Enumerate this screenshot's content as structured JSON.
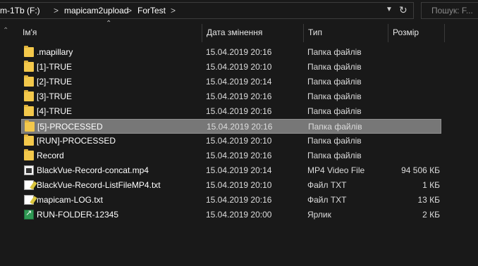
{
  "address": {
    "crumbs": [
      "m-1Tb (F:)",
      "mapicam2upload",
      "ForTest"
    ],
    "separators": [
      ">",
      ">",
      ">"
    ]
  },
  "search": {
    "placeholder": "Пошук: F..."
  },
  "columns": {
    "name": "Ім'я",
    "date": "Дата змінення",
    "type": "Тип",
    "size": "Розмір"
  },
  "files": [
    {
      "name": ".mapillary",
      "date": "15.04.2019 20:16",
      "type": "Папка файлів",
      "size": "",
      "icon": "folder-icon"
    },
    {
      "name": "[1]-TRUE",
      "date": "15.04.2019 20:10",
      "type": "Папка файлів",
      "size": "",
      "icon": "folder-icon"
    },
    {
      "name": "[2]-TRUE",
      "date": "15.04.2019 20:14",
      "type": "Папка файлів",
      "size": "",
      "icon": "folder-icon"
    },
    {
      "name": "[3]-TRUE",
      "date": "15.04.2019 20:16",
      "type": "Папка файлів",
      "size": "",
      "icon": "folder-icon"
    },
    {
      "name": "[4]-TRUE",
      "date": "15.04.2019 20:16",
      "type": "Папка файлів",
      "size": "",
      "icon": "folder-icon"
    },
    {
      "name": "[5]-PROCESSED",
      "date": "15.04.2019 20:16",
      "type": "Папка файлів",
      "size": "",
      "icon": "folder-icon",
      "selected": true
    },
    {
      "name": "[RUN]-PROCESSED",
      "date": "15.04.2019 20:10",
      "type": "Папка файлів",
      "size": "",
      "icon": "folder-icon"
    },
    {
      "name": "Record",
      "date": "15.04.2019 20:16",
      "type": "Папка файлів",
      "size": "",
      "icon": "folder-icon"
    },
    {
      "name": "BlackVue-Record-concat.mp4",
      "date": "15.04.2019 20:14",
      "type": "MP4 Video File",
      "size": "94 506 КБ",
      "icon": "video-file-icon"
    },
    {
      "name": "BlackVue-Record-ListFileMP4.txt",
      "date": "15.04.2019 20:10",
      "type": "Файл TXT",
      "size": "1 КБ",
      "icon": "text-file-icon"
    },
    {
      "name": "mapicam-LOG.txt",
      "date": "15.04.2019 20:16",
      "type": "Файл TXT",
      "size": "13 КБ",
      "icon": "text-file-icon"
    },
    {
      "name": "RUN-FOLDER-12345",
      "date": "15.04.2019 20:00",
      "type": "Ярлик",
      "size": "2 КБ",
      "icon": "shortcut-icon"
    }
  ],
  "colors": {
    "background": "#191919",
    "selection": "#777777",
    "folder": "#f3c84b"
  }
}
